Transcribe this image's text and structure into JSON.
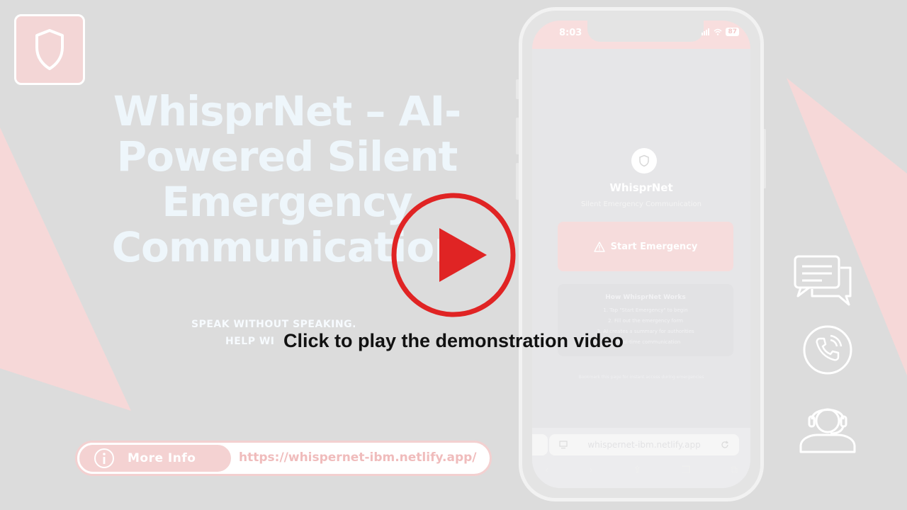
{
  "colors": {
    "background": "#dcdcdc",
    "accent_pink": "#f7d6d6",
    "play_red": "#e02424",
    "title_white": "#eef6fb"
  },
  "hero": {
    "title": "WhisprNet – AI-Powered Silent Emergency Communication",
    "tagline_line1": "Speak without speaking.",
    "tagline_line2": "Help wi"
  },
  "info_bar": {
    "button_label": "More Info",
    "url": "https://whispernet-ibm.netlify.app/"
  },
  "video": {
    "caption": "Click to play the demonstration video"
  },
  "phone": {
    "status": {
      "time": "8:03",
      "battery": "87"
    },
    "app": {
      "name": "WhisprNet",
      "subtitle": "Silent Emergency Communication",
      "start_button": "Start Emergency",
      "how_title": "How WhisprNet Works",
      "steps": [
        "1. Tap \"Start Emergency\" to begin",
        "2. Fill out the emergency form",
        "3. AI creates a summary for authorities",
        "4. Real-time communication"
      ],
      "footnote": "Bookmark this page for instant access during emergencies"
    },
    "browser": {
      "url": "whispernet-ibm.netlify.app"
    }
  },
  "icons": {
    "badge": "shield-icon",
    "right": [
      "chat-bubbles-icon",
      "phone-call-icon",
      "support-agent-icon"
    ]
  }
}
